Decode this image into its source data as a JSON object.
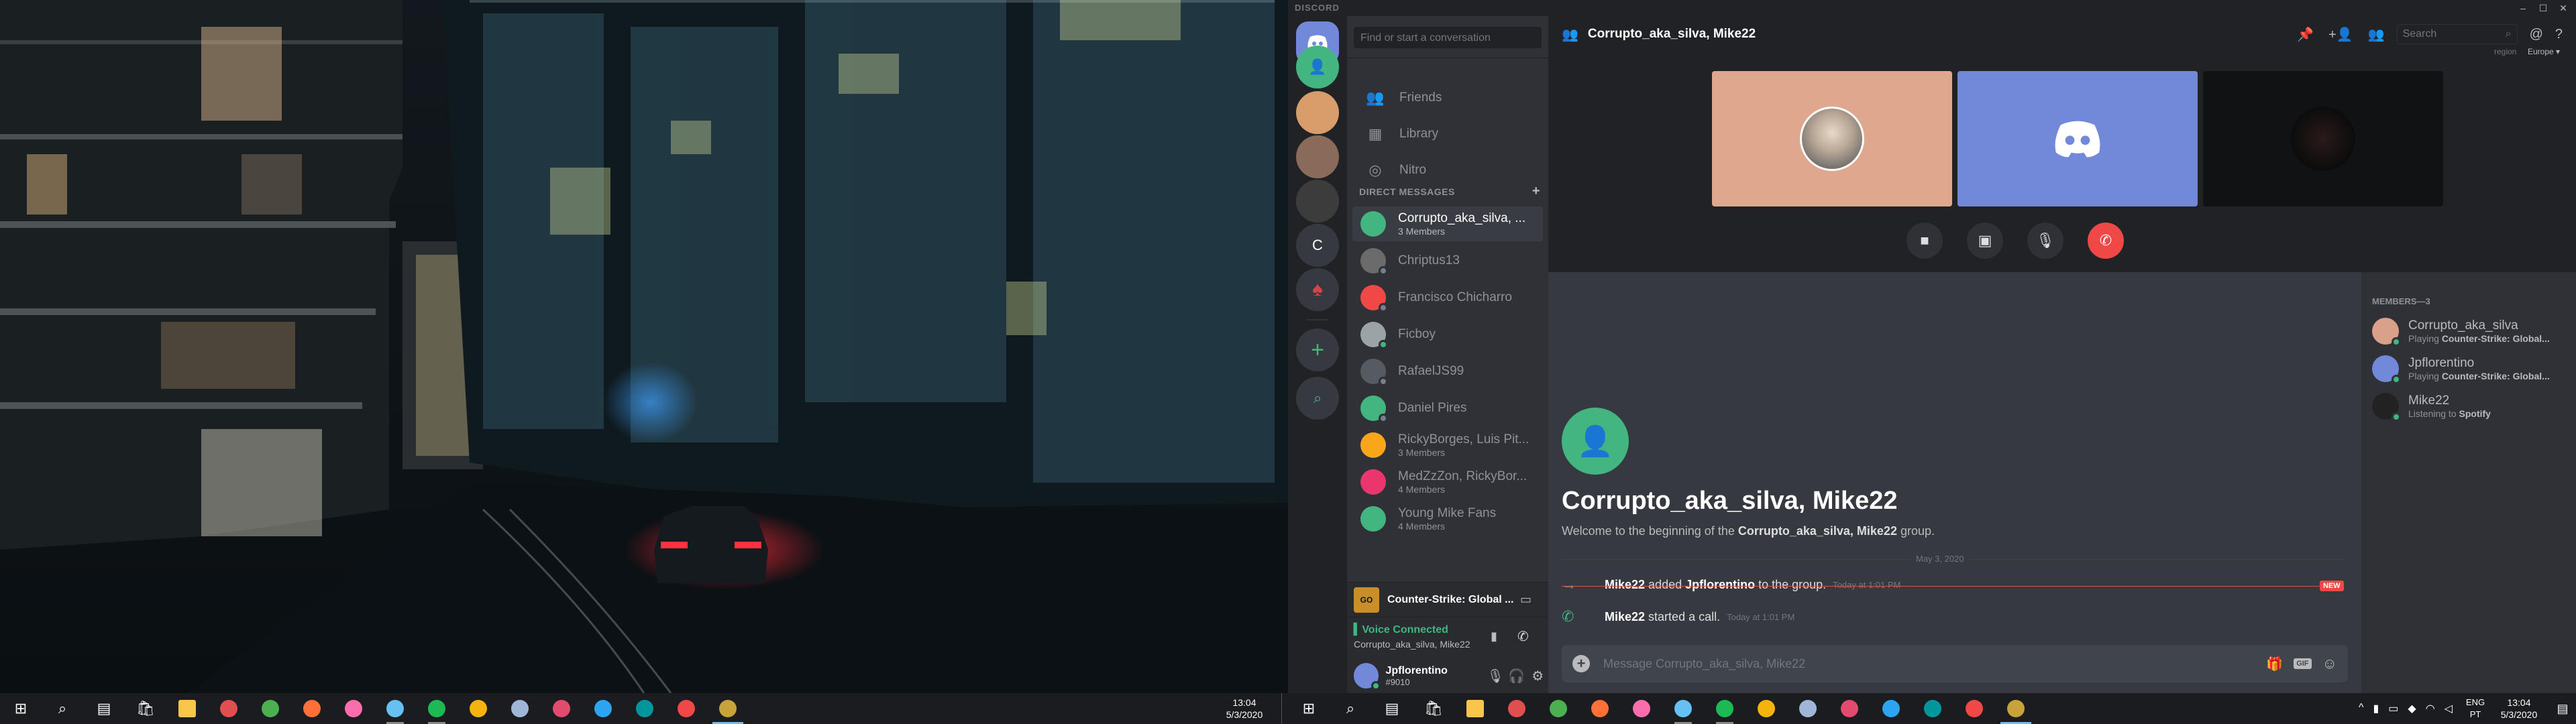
{
  "left_taskbar": {
    "apps": [
      {
        "icon": "windows-start-icon",
        "color": "#ffffff"
      },
      {
        "icon": "search-icon",
        "color": "#ffffff"
      },
      {
        "icon": "task-view-icon",
        "color": "#ffffff"
      },
      {
        "icon": "store-icon",
        "color": "#ffffff"
      },
      {
        "icon": "file-explorer-icon",
        "color": "#f8c64b"
      },
      {
        "icon": "popcorn-icon",
        "color": "#e04f4f"
      },
      {
        "icon": "chrome-icon",
        "color": "#4caf50"
      },
      {
        "icon": "firefox-icon",
        "color": "#ff7139"
      },
      {
        "icon": "itunes-icon",
        "color": "#fc6dab"
      },
      {
        "icon": "steam-icon",
        "color": "#66c0f4"
      },
      {
        "icon": "spotify-icon",
        "color": "#1db954"
      },
      {
        "icon": "battlenet-icon",
        "color": "#f5b40c"
      },
      {
        "icon": "cube-app-icon",
        "color": "#9fb6d9"
      },
      {
        "icon": "jetbrains-icon",
        "color": "#e14b6e"
      },
      {
        "icon": "vscode-icon",
        "color": "#2ca4f0"
      },
      {
        "icon": "arduino-icon",
        "color": "#00979c"
      },
      {
        "icon": "discord-app-icon",
        "color": "#f04747"
      },
      {
        "icon": "game-app-icon",
        "color": "#c8a23a"
      }
    ],
    "time": "13:04",
    "date": "5/3/2020"
  },
  "right_taskbar": {
    "time": "13:04",
    "date": "5/3/2020",
    "language": "ENG",
    "region": "PT"
  },
  "discord": {
    "brand": "DISCORD",
    "window_controls": [
      "–",
      "☐",
      "✕"
    ],
    "search_conversation_placeholder": "Find or start a conversation",
    "nav": [
      {
        "label": "Friends",
        "icon": "friends-icon"
      },
      {
        "label": "Library",
        "icon": "library-icon"
      },
      {
        "label": "Nitro",
        "icon": "nitro-icon"
      }
    ],
    "direct_messages_label": "DIRECT MESSAGES",
    "direct_messages_add": "+",
    "dms": [
      {
        "name": "Corrupto_aka_silva, ...",
        "sub": "3 Members",
        "color": "#43b581",
        "status": "",
        "selected": true
      },
      {
        "name": "Chriptus13",
        "sub": "",
        "color": "#6b6b6b",
        "status": "#747f8d",
        "selected": false
      },
      {
        "name": "Francisco Chicharro",
        "sub": "",
        "color": "#f04747",
        "status": "#747f8d",
        "selected": false
      },
      {
        "name": "Ficboy",
        "sub": "",
        "color": "#9aa3a6",
        "status": "#43b581",
        "selected": false
      },
      {
        "name": "RafaelJS99",
        "sub": "",
        "color": "#555b60",
        "status": "#747f8d",
        "selected": false
      },
      {
        "name": "Daniel Pires",
        "sub": "",
        "color": "#43b581",
        "status": "#747f8d",
        "selected": false
      },
      {
        "name": "RickyBorges, Luis Pit...",
        "sub": "3 Members",
        "color": "#faa61a",
        "status": "",
        "selected": false
      },
      {
        "name": "MedZzZon, RickyBor...",
        "sub": "4 Members",
        "color": "#e9366f",
        "status": "",
        "selected": false
      },
      {
        "name": "Young Mike Fans",
        "sub": "4 Members",
        "color": "#43b581",
        "status": "",
        "selected": false
      }
    ],
    "game_activity": "Counter-Strike: Global ...",
    "game_icon_label": "GO",
    "voice": {
      "status": "Voice Connected",
      "channel": "Corrupto_aka_silva, Mike22"
    },
    "user": {
      "name": "Jpflorentino",
      "tag": "#9010"
    },
    "header": {
      "title": "Corrupto_aka_silva, Mike22",
      "search_placeholder": "Search",
      "region_label": "region",
      "region_value": "Europe"
    },
    "guild_letter": "C",
    "chat": {
      "welcome_title": "Corrupto_aka_silva, Mike22",
      "welcome_prefix": "Welcome to the beginning of the ",
      "welcome_bold": "Corrupto_aka_silva, Mike22",
      "welcome_suffix": " group.",
      "date_divider": "May 3, 2020",
      "system_messages": [
        {
          "actor": "Mike22",
          "action": " added ",
          "target": "Jpflorentino",
          "rest": " to the group.",
          "time": "Today at 1:01 PM",
          "icon": "member-join-arrow-icon",
          "new": true
        },
        {
          "actor": "Mike22",
          "action": " started a call.",
          "target": "",
          "rest": "",
          "time": "Today at 1:01 PM",
          "icon": "call-started-icon",
          "new": false
        }
      ],
      "new_badge": "NEW",
      "message_placeholder": "Message Corrupto_aka_silva, Mike22",
      "gif_label": "GIF"
    },
    "members_label": "MEMBERS—3",
    "members": [
      {
        "name": "Corrupto_aka_silva",
        "activity_prefix": "Playing ",
        "activity_bold": "Counter-Strike: Global...",
        "color": "#d9a08a"
      },
      {
        "name": "Jpflorentino",
        "activity_prefix": "Playing ",
        "activity_bold": "Counter-Strike: Global...",
        "color": "#7289da"
      },
      {
        "name": "Mike22",
        "activity_prefix": "Listening to ",
        "activity_bold": "Spotify",
        "color": "#222222"
      }
    ],
    "colors": {
      "blurple": "#7289da",
      "green": "#43b581",
      "red": "#f04747",
      "tile_peach": "#dfa88e"
    }
  }
}
